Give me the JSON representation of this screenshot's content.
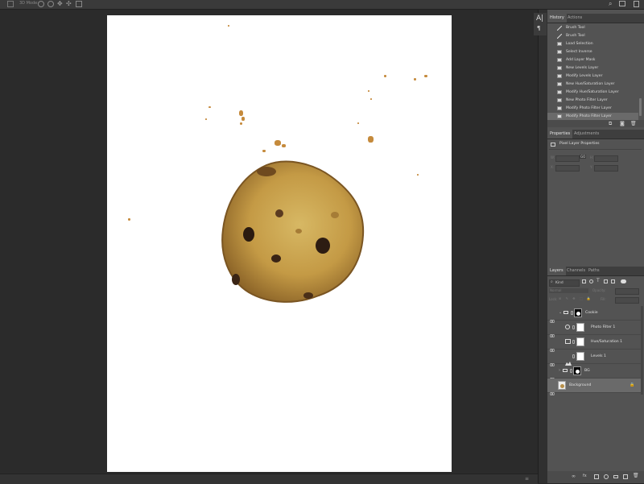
{
  "options_bar": {
    "zoom_label": "3D Mode:"
  },
  "history_panel": {
    "tabs": [
      "History",
      "Actions"
    ],
    "items": [
      "Brush Tool",
      "Brush Tool",
      "Load Selection",
      "Select Inverse",
      "Add Layer Mask",
      "New Levels Layer",
      "Modify Levels Layer",
      "New Hue/Saturation Layer",
      "Modify Hue/Saturation Layer",
      "New Photo Filter Layer",
      "Modify Photo Filter Layer",
      "Modify Photo Filter Layer"
    ],
    "selected_index": 11
  },
  "properties_panel": {
    "tabs": [
      "Properties",
      "Adjustments"
    ],
    "section_title": "Pixel Layer Properties",
    "w_label": "W:",
    "h_label": "H:",
    "x_label": "X:",
    "y_label": "Y:",
    "link_label": "GO"
  },
  "layers_panel": {
    "tabs": [
      "Layers",
      "Channels",
      "Paths"
    ],
    "kind_filter": "Kind",
    "blend_mode": "Normal",
    "opacity_label": "Opacity:",
    "lock_label": "Lock:",
    "fill_label": "Fill:",
    "layers": [
      {
        "name": "Cookie",
        "type": "group"
      },
      {
        "name": "Photo Filter 1",
        "type": "adjustment"
      },
      {
        "name": "Hue/Saturation 1",
        "type": "adjustment"
      },
      {
        "name": "Levels 1",
        "type": "adjustment"
      },
      {
        "name": "BG",
        "type": "group"
      },
      {
        "name": "Background",
        "type": "pixel"
      }
    ]
  },
  "colors": {
    "panel_bg": "#535353",
    "workspace_bg": "#2b2b2b",
    "selected_row": "#6a6a6a",
    "cookie": "#c8a04a"
  }
}
